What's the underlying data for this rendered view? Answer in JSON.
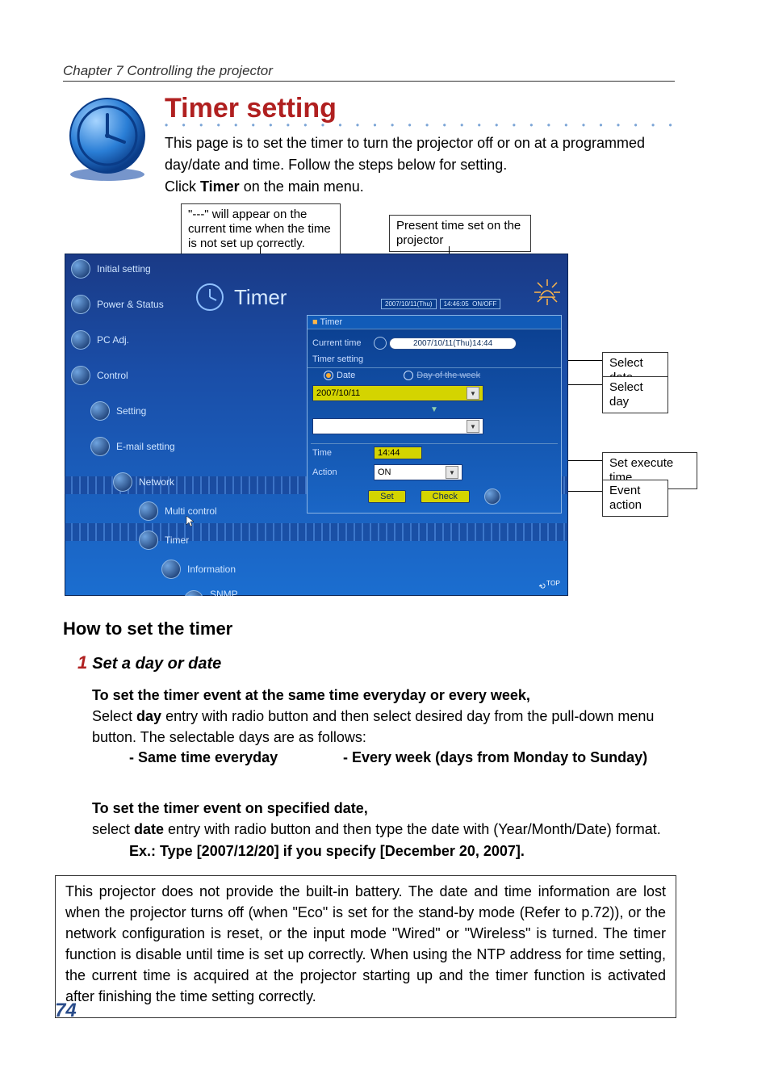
{
  "chapter": "Chapter 7 Controlling the projector",
  "title": "Timer setting",
  "intro_line1": "This page is to set the timer to turn the projector off or on at a programmed day/date and time. Follow the steps below for setting.",
  "intro_line2_pre": "Click ",
  "intro_line2_bold": "Timer",
  "intro_line2_post": " on the main menu.",
  "callouts": {
    "current_time_na": "\"---\" will appear on the current time when the time is not set up correctly.",
    "present_time": "Present time set on the projector",
    "select_date": "Select date",
    "select_day": "Select day",
    "set_execute": "Set execute time",
    "event_action": "Event action"
  },
  "sidebar": [
    "Initial setting",
    "Power & Status",
    "PC Adj.",
    "Control",
    "Setting",
    "E-mail setting",
    "Network",
    "Multi control",
    "Timer",
    "Information",
    "SNMP setting"
  ],
  "shot": {
    "title": "Timer",
    "header_date": "2007/10/11(Thu)",
    "header_time": "14:46:05",
    "header_onoff": "ON/OFF",
    "panel_head": "Timer",
    "current_time_label": "Current time",
    "current_time_value": "2007/10/11(Thu)14:44",
    "timer_setting_label": "Timer setting",
    "radio_date": "Date",
    "radio_day": "Day of the week",
    "date_value": "2007/10/11",
    "time_label": "Time",
    "time_value": "14:44",
    "action_label": "Action",
    "action_value": "ON",
    "btn_set": "Set",
    "btn_check": "Check",
    "top_link": "TOP"
  },
  "h2": "How to set the timer",
  "step1_num": "1",
  "step1_text": "Set a day or date",
  "p1": "To set the timer event at the same time everyday or every week,",
  "p2_pre": "Select ",
  "p2_bold": "day",
  "p2_post": " entry with radio button and then select desired day from the pull-down menu button. The selectable days are as follows:",
  "opt1": "- Same time everyday",
  "opt2": "- Every week (days from Monday to Sunday)",
  "p3": "To set the timer event on specified date,",
  "p4_pre": "select ",
  "p4_bold": "date",
  "p4_post": " entry with radio button and then type the date with (Year/Month/Date) format.",
  "p5": "Ex.: Type [2007/12/20] if you specify [December 20, 2007].",
  "note": "This projector does not provide the built-in battery.  The date and time information are lost when the projector turns off (when \"Eco\" is set for the stand-by mode (Refer to p.72)), or the network configuration is reset, or the input mode \"Wired\" or \"Wireless\" is turned. The timer function is disable until time is set up correctly. When using the NTP address for time setting, the current time is acquired at the projector starting up and the timer function is activated after finishing the time setting correctly.",
  "page_number": "74"
}
